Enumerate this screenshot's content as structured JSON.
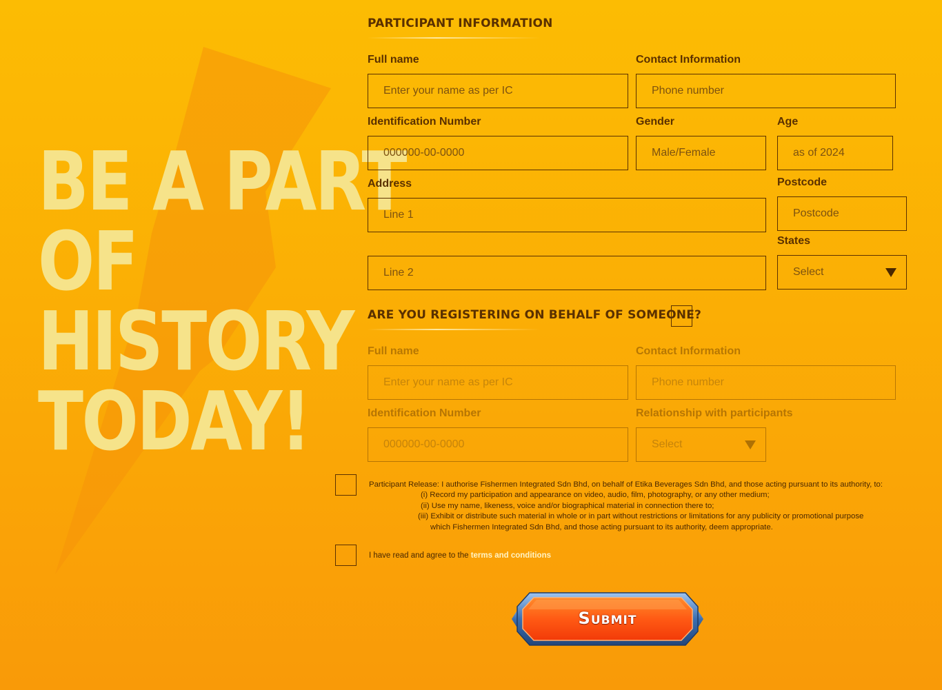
{
  "hero": {
    "lines": [
      "BE A PART",
      "OF",
      "HISTORY",
      "TODAY!"
    ]
  },
  "participant": {
    "title": "PARTICIPANT INFORMATION",
    "full_name": {
      "label": "Full name",
      "placeholder": "Enter your name as per IC"
    },
    "contact": {
      "label": "Contact Information",
      "placeholder": "Phone number"
    },
    "ic": {
      "label": "Identification Number",
      "placeholder": "000000-00-0000"
    },
    "gender": {
      "label": "Gender",
      "placeholder": "Male/Female"
    },
    "age": {
      "label": "Age",
      "placeholder": "as of 2024"
    },
    "address": {
      "label": "Address",
      "line1_placeholder": "Line 1",
      "line2_placeholder": "Line 2"
    },
    "postcode": {
      "label": "Postcode",
      "placeholder": "Postcode"
    },
    "states": {
      "label": "States",
      "selected": "Select"
    }
  },
  "behalf": {
    "title": "ARE YOU REGISTERING ON BEHALF OF SOMEONE?",
    "full_name": {
      "label": "Full name",
      "placeholder": "Enter your name as per IC"
    },
    "contact": {
      "label": "Contact Information",
      "placeholder": "Phone number"
    },
    "ic": {
      "label": "Identification Number",
      "placeholder": "000000-00-0000"
    },
    "relationship": {
      "label": "Relationship with participants",
      "selected": "Select"
    }
  },
  "release": {
    "intro": "Participant Release: I authorise Fishermen Integrated Sdn Bhd, on behalf of Etika Beverages Sdn Bhd, and those acting pursuant to its authority, to:",
    "item1": "(i) Record my participation and appearance on video, audio, film, photography, or any other medium;",
    "item2": "(ii) Use my name, likeness, voice and/or biographical material in connection there to;",
    "item3": "(iii) Exhibit or distribute such material in whole or in part without restrictions or limitations for any publicity or promotional purpose",
    "item3b": "which Fishermen Integrated Sdn Bhd, and those acting pursuant to its authority, deem appropriate."
  },
  "agree": {
    "text": "I have read and agree to the ",
    "link": "terms and conditions"
  },
  "submit": {
    "label": "Submit"
  },
  "colors": {
    "accent": "#5a3000",
    "hero": "#f6e38a",
    "button": "#ff5a1a",
    "button_frame": "#3c6fb0"
  },
  "icons": {
    "dropdown": "triangle-down-icon",
    "bolt": "lightning-bolt-icon"
  }
}
